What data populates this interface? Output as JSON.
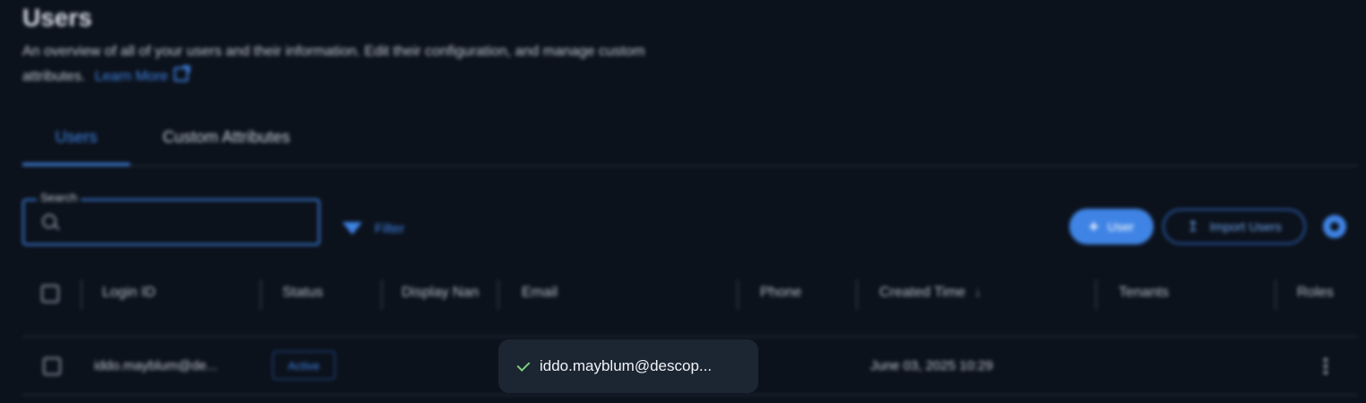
{
  "page": {
    "title": "Users",
    "description": "An overview of all of your users and their information. Edit their configuration, and manage custom attributes.",
    "learn_more": "Learn More"
  },
  "tabs": [
    {
      "label": "Users",
      "active": true
    },
    {
      "label": "Custom Attributes",
      "active": false
    }
  ],
  "search": {
    "label": "Search",
    "value": "",
    "placeholder": ""
  },
  "toolbar": {
    "filter_label": "Filter",
    "add_user_label": "User",
    "import_label": "Import Users"
  },
  "table": {
    "columns": [
      "Login ID",
      "Status",
      "Display Nan",
      "Email",
      "Phone",
      "Created Time",
      "Tenants",
      "Roles"
    ],
    "rows": [
      {
        "login_id": "iddo.mayblum@de...",
        "status": "Active",
        "display_name": "",
        "email": "",
        "phone": "",
        "created_time": "June 03, 2025 10:29",
        "tenants": "",
        "roles": ""
      }
    ]
  },
  "toast": {
    "message": "iddo.mayblum@descop..."
  },
  "colors": {
    "background": "#0c121c",
    "accent": "#3f84e5",
    "toast_bg": "#1c2532",
    "success": "#7fd07f"
  }
}
